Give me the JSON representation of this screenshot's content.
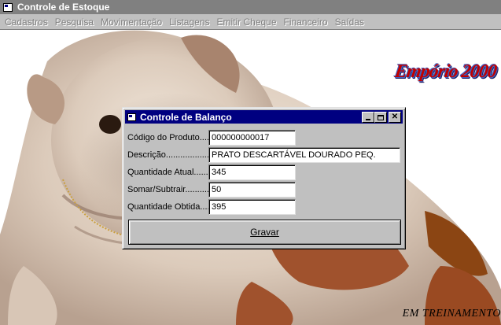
{
  "main_window": {
    "title": "Controle de Estoque"
  },
  "menu": [
    "Cadastros",
    "Pesquisa",
    "Movimentação",
    "Listagens",
    "Emitir Cheque",
    "Financeiro",
    "Saídas"
  ],
  "branding": {
    "logo_text": "Empório 2000",
    "footer_text": "EM TREINAMENTO"
  },
  "dialog": {
    "title": "Controle de Balanço",
    "fields": {
      "codigo": {
        "label": "Código do Produto.....",
        "value": "000000000017"
      },
      "descricao": {
        "label": "Descrição...................",
        "value": "PRATO DESCARTÁVEL DOURADO PEQ."
      },
      "qtd_atual": {
        "label": "Quantidade Atual.........",
        "value": "345"
      },
      "somar": {
        "label": "Somar/Subtrair............",
        "value": "50"
      },
      "qtd_obtida": {
        "label": "Quantidade Obtida.......",
        "value": "395"
      }
    },
    "gravar_label": "Gravar"
  },
  "colors": {
    "titlebar_active": "#000080",
    "titlebar_inactive": "#808080",
    "face": "#c0c0c0"
  }
}
